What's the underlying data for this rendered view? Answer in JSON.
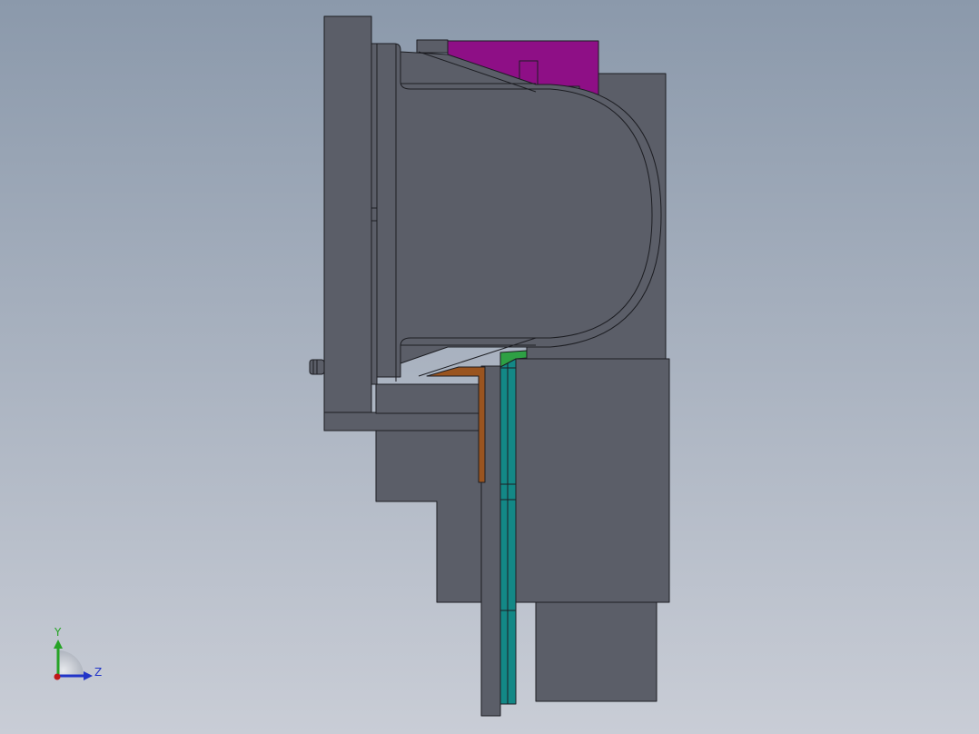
{
  "colors": {
    "background_top": "#8b99ab",
    "background_bottom": "#c9cdd6",
    "part_body": "#5b5e68",
    "edge": "#1c1d22",
    "accent_magenta": "#8e0f86",
    "accent_orange": "#9a541f",
    "accent_teal": "#138886",
    "accent_green": "#2ea044",
    "axis_y": "#26a326",
    "axis_z": "#2235c8",
    "axis_x": "#c01818"
  },
  "view_triad": {
    "y_label": "Y",
    "z_label": "Z",
    "x_icon": "x-axis-dot-icon",
    "y_icon": "y-axis-arrow-icon",
    "z_icon": "z-axis-arrow-icon"
  },
  "model": {
    "description_icon": "cad-section-view"
  }
}
